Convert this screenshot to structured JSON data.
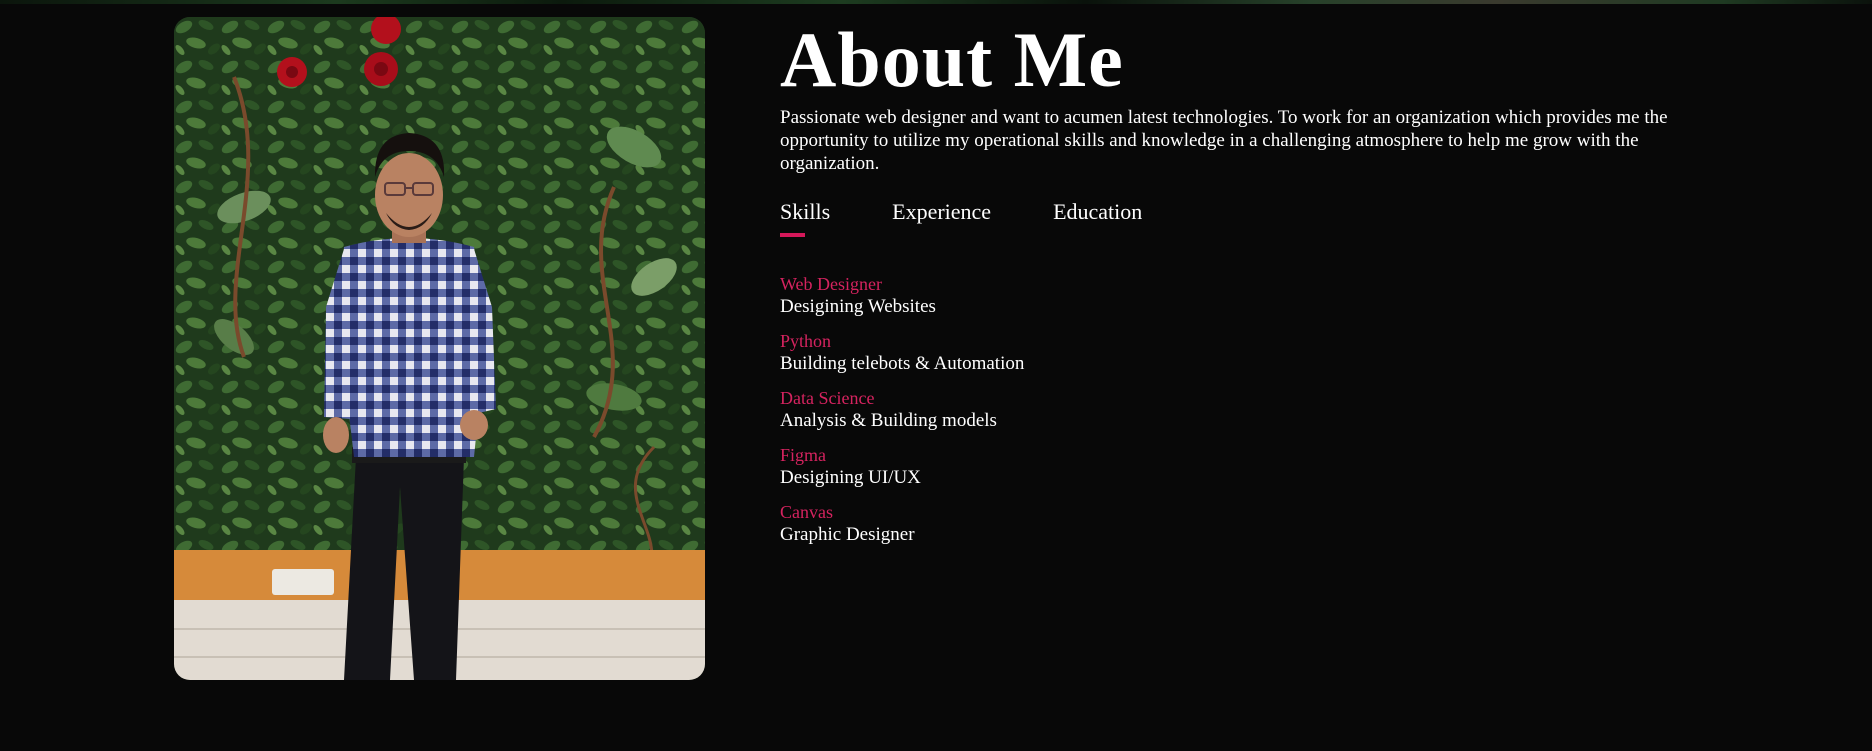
{
  "about": {
    "title": "About Me",
    "intro": "Passionate web designer and want to acumen latest technologies. To work for an organization which provides me the opportunity to utilize my operational skills and knowledge in a challenging atmosphere to help me grow with the organization."
  },
  "tabs": [
    {
      "label": "Skills",
      "active": true
    },
    {
      "label": "Experience",
      "active": false
    },
    {
      "label": "Education",
      "active": false
    }
  ],
  "skills": [
    {
      "name": "Web Designer",
      "desc": "Desigining Websites"
    },
    {
      "name": "Python",
      "desc": "Building telebots & Automation"
    },
    {
      "name": "Data Science",
      "desc": "Analysis & Building models"
    },
    {
      "name": "Figma",
      "desc": "Desigining UI/UX"
    },
    {
      "name": "Canvas",
      "desc": "Graphic Designer"
    }
  ],
  "colors": {
    "background": "#080808",
    "accent": "#d5185a",
    "text": "#ffffff"
  }
}
